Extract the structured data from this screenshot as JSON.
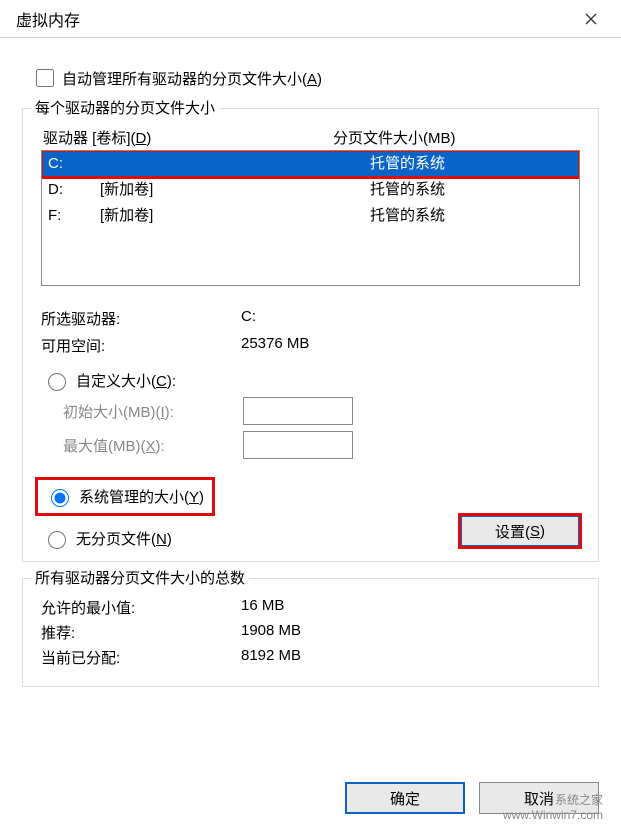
{
  "window": {
    "title": "虚拟内存"
  },
  "auto_manage": {
    "label_pre": "自动管理所有驱动器的分页文件大小(",
    "label_key": "A",
    "label_post": ")",
    "checked": false
  },
  "drives_group": {
    "legend": "每个驱动器的分页文件大小",
    "header_drive_pre": "驱动器 [卷标](",
    "header_drive_key": "D",
    "header_drive_post": ")",
    "header_paging": "分页文件大小(MB)",
    "rows": [
      {
        "letter": "C:",
        "volume": "",
        "paging": "托管的系统",
        "selected": true
      },
      {
        "letter": "D:",
        "volume": "[新加卷]",
        "paging": "托管的系统",
        "selected": false
      },
      {
        "letter": "F:",
        "volume": "[新加卷]",
        "paging": "托管的系统",
        "selected": false
      }
    ],
    "selected_drive_label": "所选驱动器:",
    "selected_drive_value": "C:",
    "free_space_label": "可用空间:",
    "free_space_value": "25376 MB",
    "custom_size_pre": "自定义大小(",
    "custom_size_key": "C",
    "custom_size_post": "):",
    "initial_pre": "初始大小(MB)(",
    "initial_key": "I",
    "initial_post": "):",
    "initial_value": "",
    "max_pre": "最大值(MB)(",
    "max_key": "X",
    "max_post": "):",
    "max_value": "",
    "system_managed_pre": "系统管理的大小(",
    "system_managed_key": "Y",
    "system_managed_post": ")",
    "no_paging_pre": "无分页文件(",
    "no_paging_key": "N",
    "no_paging_post": ")",
    "set_btn_pre": "设置(",
    "set_btn_key": "S",
    "set_btn_post": ")",
    "size_mode": "system"
  },
  "totals_group": {
    "legend": "所有驱动器分页文件大小的总数",
    "min_label": "允许的最小值:",
    "min_value": "16 MB",
    "rec_label": "推荐:",
    "rec_value": "1908 MB",
    "cur_label": "当前已分配:",
    "cur_value": "8192 MB"
  },
  "buttons": {
    "ok": "确定",
    "cancel": "取消"
  },
  "watermark": {
    "line1": "系统之家",
    "line2": "www.Winwin7.com"
  }
}
